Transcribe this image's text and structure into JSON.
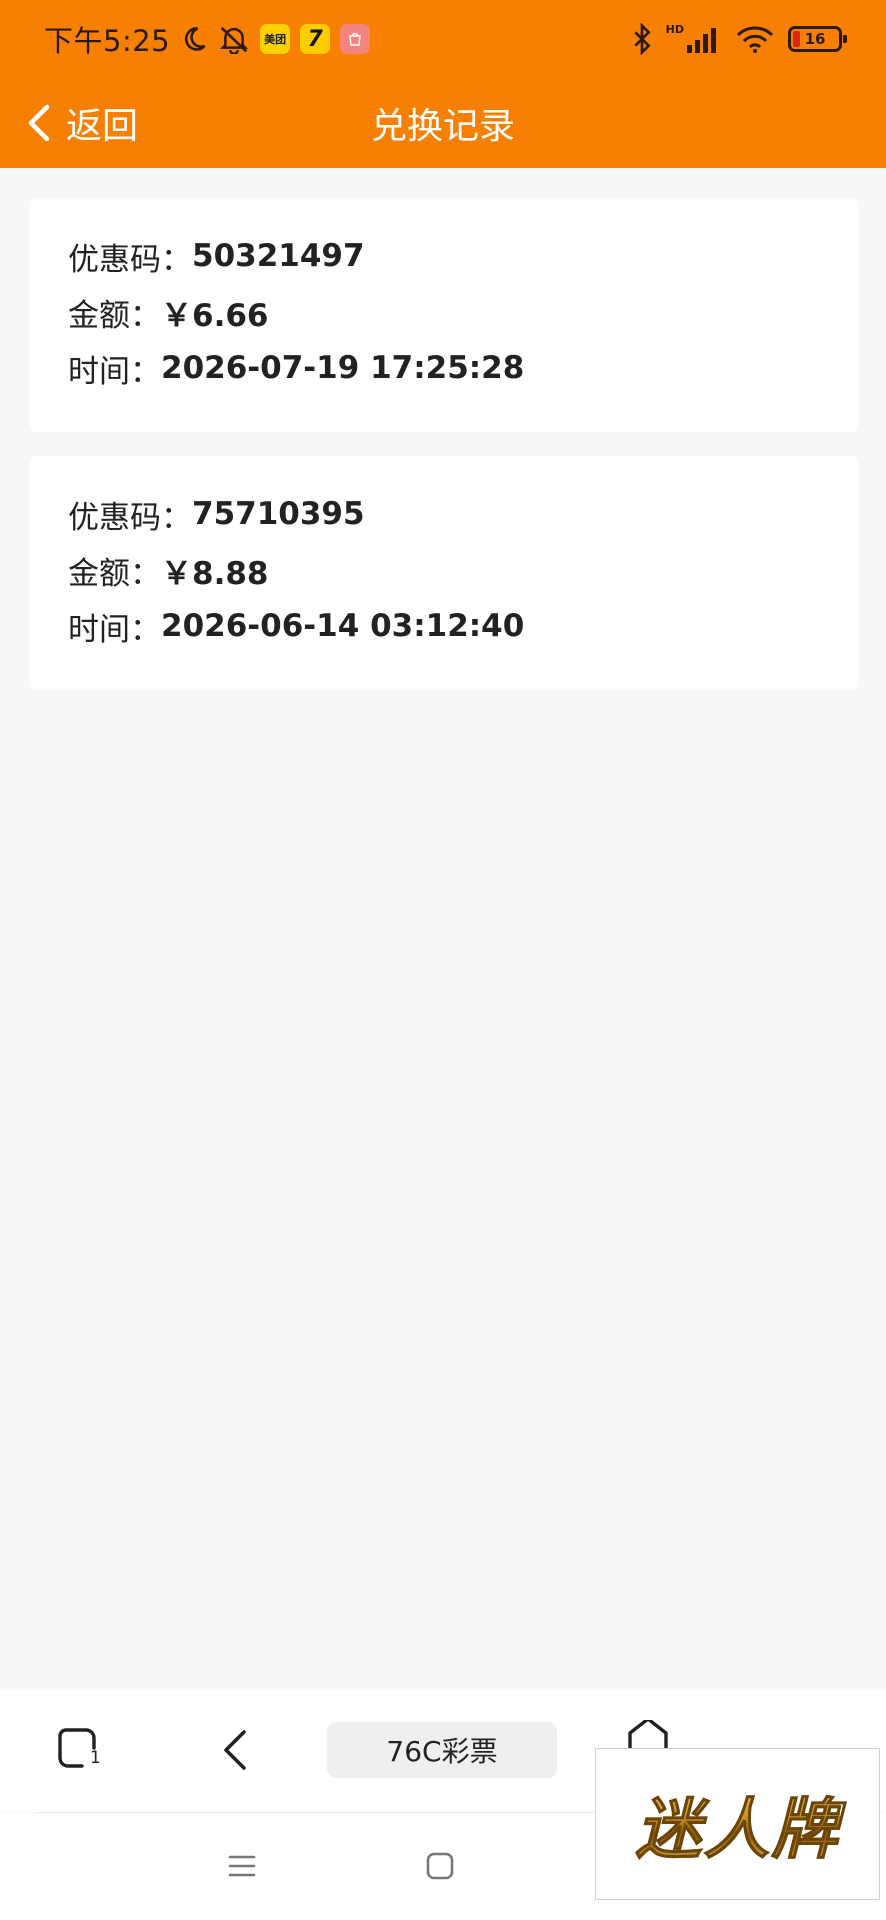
{
  "status_bar": {
    "time": "下午5:25",
    "app_badges": [
      {
        "name": "meituan-app-icon",
        "text": "美团",
        "color": "#ffd100"
      },
      {
        "name": "qimao-app-icon",
        "text": "7",
        "color": "#ffcc00"
      },
      {
        "name": "shopping-app-icon",
        "text": "",
        "color": "#f4847e"
      }
    ],
    "network_label": "HD",
    "battery_level": "16",
    "icons": [
      "moon-icon",
      "notifications-off-icon",
      "bluetooth-icon",
      "signal-icon",
      "wifi-icon",
      "battery-icon"
    ]
  },
  "nav": {
    "back_label": "返回",
    "title": "兑换记录"
  },
  "labels": {
    "code": "优惠码：",
    "amount": "金额：",
    "time": "时间："
  },
  "records": [
    {
      "code": "50321497",
      "amount": "￥6.66",
      "time": "2026-07-19 17:25:28"
    },
    {
      "code": "75710395",
      "amount": "￥8.88",
      "time": "2026-06-14 03:12:40"
    }
  ],
  "toolbar": {
    "tab_count": "1",
    "address_label": "76C彩票",
    "icons": [
      "tabs-icon",
      "back-icon",
      "home-icon",
      "menu-icon"
    ]
  },
  "system_nav": {
    "icons": [
      "recent-apps-icon",
      "home-square-icon",
      "back-triangle-icon"
    ]
  },
  "watermark": {
    "text": "迷人牌"
  },
  "colors": {
    "header": "#f77f02",
    "background": "#f7f8fa",
    "card": "#ffffff"
  }
}
